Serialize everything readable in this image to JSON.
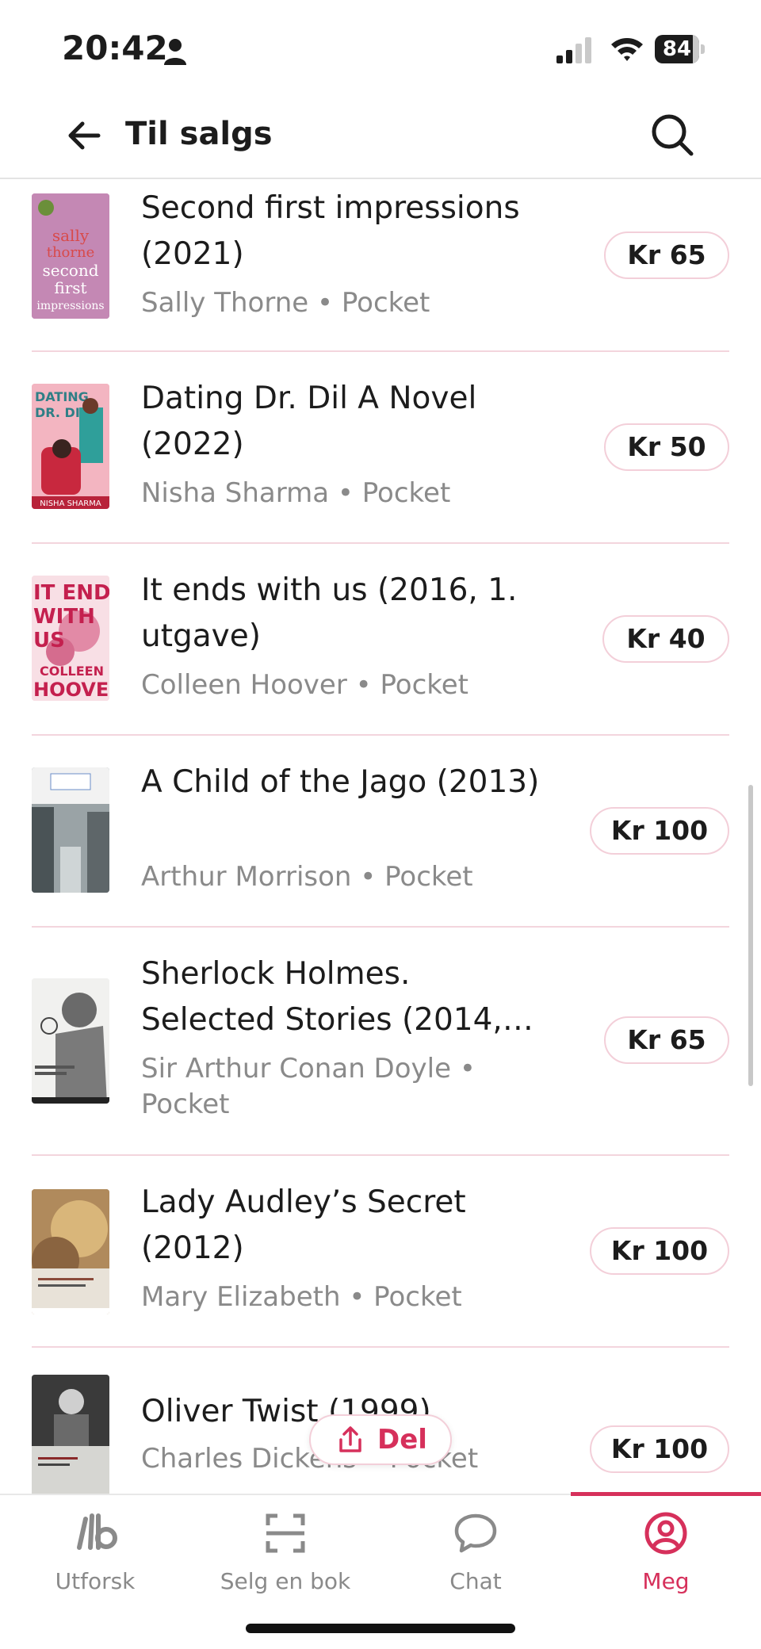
{
  "status_bar": {
    "time": "20:42",
    "battery": "84"
  },
  "header": {
    "title": "Til salgs"
  },
  "books": [
    {
      "title": "Second first impressions (2021)",
      "meta": "Sally Thorne • Pocket",
      "price": "Kr 65",
      "cover_color": "#b26f9f",
      "cover_text": "sally thorne second first impressions"
    },
    {
      "title": "Dating Dr. Dil A Novel (2022)",
      "meta": "Nisha Sharma • Pocket",
      "price": "Kr 50",
      "cover_color": "#f2a6b4",
      "cover_text": "DATING DR. DIL"
    },
    {
      "title": "It ends with us (2016, 1. utgave)",
      "meta": "Colleen Hoover • Pocket",
      "price": "Kr 40",
      "cover_color": "#f6d9e0",
      "cover_text": "IT ENDS WITH US"
    },
    {
      "title": "A Child of the Jago (2013)",
      "meta": "Arthur Morrison • Pocket",
      "price": "Kr 100",
      "cover_color": "#8a9396",
      "cover_text": ""
    },
    {
      "title": "Sherlock Holmes. Selected Stories (2014,…",
      "meta": "Sir Arthur Conan Doyle • Pocket",
      "price": "Kr 65",
      "cover_color": "#e9e9e7",
      "cover_text": ""
    },
    {
      "title": "Lady Audley’s Secret (2012)",
      "meta": "Mary Elizabeth • Pocket",
      "price": "Kr 100",
      "cover_color": "#9d7a4e",
      "cover_text": ""
    },
    {
      "title": "Oliver Twist (1999)",
      "meta": "Charles Dickens • Pocket",
      "price": "Kr 100",
      "cover_color": "#4a4a4a",
      "cover_text": ""
    }
  ],
  "share": {
    "label": "Del"
  },
  "tabs": [
    {
      "label": "Utforsk",
      "icon": "logo-icon"
    },
    {
      "label": "Selg en bok",
      "icon": "scan-icon"
    },
    {
      "label": "Chat",
      "icon": "chat-bubble-icon"
    },
    {
      "label": "Meg",
      "icon": "profile-icon"
    }
  ],
  "colors": {
    "accent": "#d6305b",
    "muted_text": "#8a8a8a",
    "separator": "#f3d5dd"
  }
}
